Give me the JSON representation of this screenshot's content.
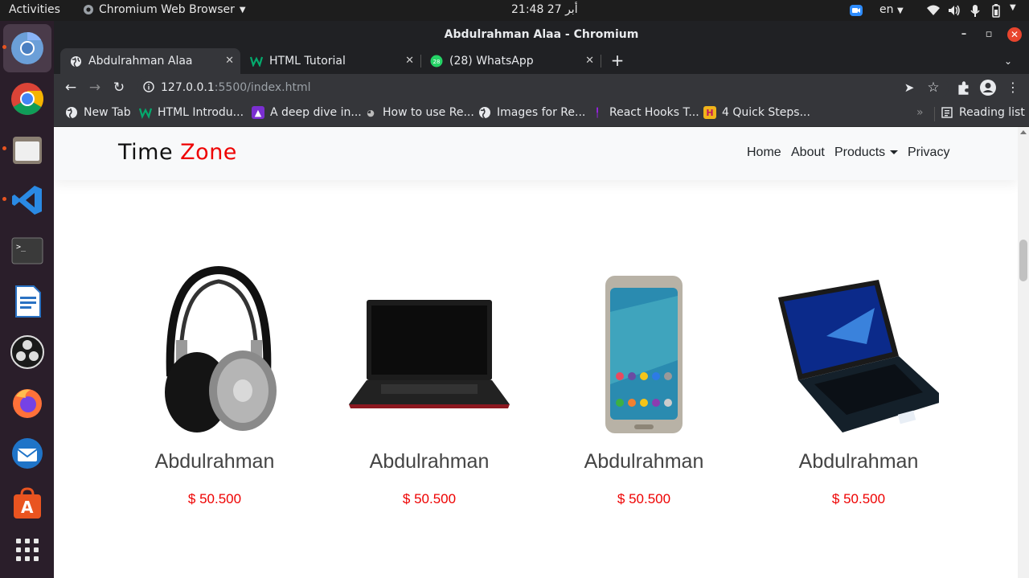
{
  "system": {
    "activities": "Activities",
    "app_name": "Chromium Web Browser",
    "clock": "21:48  أبر 27",
    "language": "en"
  },
  "window": {
    "title": "Abdulrahman Alaa - Chromium"
  },
  "tabs": [
    {
      "title": "Abdulrahman Alaa",
      "active": true
    },
    {
      "title": "HTML Tutorial",
      "active": false
    },
    {
      "title": "(28) WhatsApp",
      "active": false,
      "badge": "28"
    }
  ],
  "toolbar": {
    "url_host": "127.0.0.1",
    "url_path": ":5500/index.html"
  },
  "bookmarks": [
    {
      "label": "New Tab",
      "icon": "globe-icon"
    },
    {
      "label": "HTML Introdu...",
      "icon": "w3schools-icon"
    },
    {
      "label": "A deep dive in...",
      "icon": "purple-rocket-icon"
    },
    {
      "label": "How to use Re...",
      "icon": "koala-icon"
    },
    {
      "label": "Images for Re...",
      "icon": "globe-icon"
    },
    {
      "label": "React Hooks T...",
      "icon": "purple-bar-icon"
    },
    {
      "label": "4 Quick Steps...",
      "icon": "h-icon"
    }
  ],
  "reading_list": "Reading list",
  "site": {
    "logo_part1": "Time ",
    "logo_part2": "Zone",
    "nav": {
      "home": "Home",
      "about": "About",
      "products": "Products",
      "privacy": "Privacy"
    },
    "products": [
      {
        "name": "Abdulrahman",
        "price": "$ 50.500",
        "image": "headphones-image"
      },
      {
        "name": "Abdulrahman",
        "price": "$ 50.500",
        "image": "laptop-black-image"
      },
      {
        "name": "Abdulrahman",
        "price": "$ 50.500",
        "image": "smartphone-image"
      },
      {
        "name": "Abdulrahman",
        "price": "$ 50.500",
        "image": "laptop-blue-image"
      }
    ]
  },
  "colors": {
    "accent_red": "#e00000",
    "ubuntu_orange": "#e95420",
    "dark_chrome": "#202124"
  }
}
